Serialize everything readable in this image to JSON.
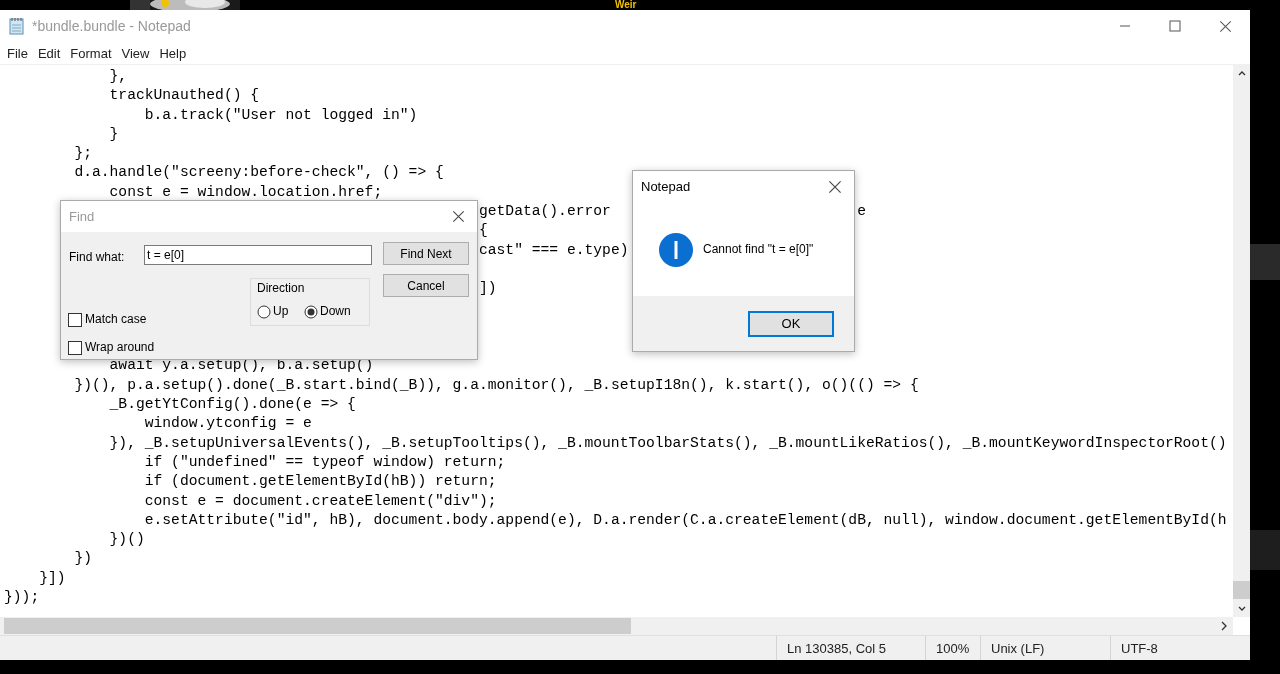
{
  "backdrop": {
    "kind": "picture",
    "caption": "Weir"
  },
  "window": {
    "title": "*bundle.bundle - Notepad"
  },
  "menu": [
    "File",
    "Edit",
    "Format",
    "View",
    "Help"
  ],
  "editor": {
    "lines": [
      {
        "segments": [
          "            },"
        ]
      },
      {
        "segments": [
          "            trackUnauthed() {"
        ]
      },
      {
        "segments": [
          "                b.a.track(\"User not logged in\")"
        ]
      },
      {
        "segments": [
          "            }"
        ]
      },
      {
        "segments": [
          "        };"
        ]
      },
      {
        "segments": [
          "        d.a.handle(\"screeny:before-check\", () => {"
        ]
      },
      {
        "segments": [
          "            const e = window.location.href;"
        ]
      },
      {
        "segments": [
          "                                                      getData().error",
          "                            e"
        ]
      },
      {
        "segments": [
          "                                                      {"
        ]
      },
      {
        "segments": [
          "                                                      cast\" === e.type)"
        ]
      },
      {
        "segments": [
          "\n                                                      ])"
        ]
      },
      {
        "segments": [
          "\n\n\n            await y.a.setup(), b.a.setup()"
        ]
      },
      {
        "segments": [
          "        })(), p.a.setup().done(_B.start.bind(_B)), g.a.monitor(), _B.setupI18n(), k.start(), o()(() => {"
        ]
      },
      {
        "segments": [
          "            _B.getYtConfig().done(e => {"
        ]
      },
      {
        "segments": [
          "                window.ytconfig = e"
        ]
      },
      {
        "segments": [
          "            }), _B.setupUniversalEvents(), _B.setupTooltips(), _B.mountToolbarStats(), _B.mountLikeRatios(), _B.mountKeywordInspectorRoot()"
        ]
      },
      {
        "segments": [
          "                if (\"undefined\" == typeof window) return;"
        ]
      },
      {
        "segments": [
          "                if (document.getElementById(hB)) return;"
        ]
      },
      {
        "segments": [
          "                const e = document.createElement(\"div\");"
        ]
      },
      {
        "segments": [
          "                e.setAttribute(\"id\", hB), document.body.append(e), D.a.render(C.a.createElement(dB, null), window.document.getElementById(h"
        ]
      },
      {
        "segments": [
          "            })()"
        ]
      },
      {
        "segments": [
          "        })"
        ]
      },
      {
        "segments": [
          "    }])"
        ]
      },
      {
        "segments": [
          "}));"
        ]
      }
    ]
  },
  "status_bar": {
    "position": "Ln 130385, Col 5",
    "zoom": "100%",
    "line_endings": "Unix (LF)",
    "encoding": "UTF-8"
  },
  "find_dialog": {
    "title": "Find",
    "find_what": {
      "label": "Find what:",
      "value": "t = e[0]"
    },
    "buttons": [
      "Find Next",
      "Cancel"
    ],
    "direction": {
      "label": "Direction",
      "options": [
        {
          "label": "Up",
          "selected": false
        },
        {
          "label": "Down",
          "selected": true
        }
      ]
    },
    "options": [
      {
        "label": "Match case",
        "checked": false
      },
      {
        "label": "Wrap around",
        "checked": false
      }
    ]
  },
  "message_box": {
    "title": "Notepad",
    "message": "Cannot find \"t = e[0]\"",
    "button": "OK"
  }
}
